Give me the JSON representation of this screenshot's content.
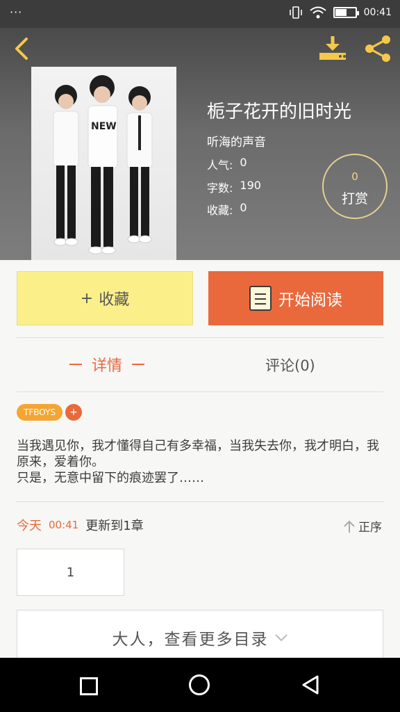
{
  "status_bar": {
    "dots": "···",
    "time": "00:41"
  },
  "book": {
    "title": "栀子花开的旧时光",
    "author": "听海的声音",
    "meta": [
      {
        "label": "人气:",
        "value": "0"
      },
      {
        "label": "字数:",
        "value": "190"
      },
      {
        "label": "收藏:",
        "value": "0"
      }
    ],
    "reward_count": "0",
    "reward_label": "打赏",
    "cover_text": "NEW"
  },
  "actions": {
    "collect_plus": "+",
    "collect_label": "收藏",
    "read_label": "开始阅读"
  },
  "tabs": {
    "detail": "详情",
    "comments": "评论(0)"
  },
  "tags": {
    "tag": "TFBOYS",
    "add": "+"
  },
  "description": {
    "line1": "当我遇见你，我才懂得自己有多幸福，当我失去你，我才明白，我原来，爱着你。",
    "line2": "只是，无意中留下的痕迹罢了……"
  },
  "update": {
    "today": "今天",
    "time": "00:41",
    "text": "更新到1章",
    "sort": "正序"
  },
  "chapter": {
    "number": "1"
  },
  "more_catalog": "大人，查看更多目录",
  "colors": {
    "accent": "#e9693c",
    "collect_bg": "#fbef8a",
    "tag_bg": "#f5a533"
  },
  "icons": [
    "back-icon",
    "download-icon",
    "share-icon",
    "book-icon",
    "sort-up-icon",
    "chevron-down-icon",
    "nav-back-icon",
    "nav-home-icon",
    "nav-recent-icon"
  ]
}
